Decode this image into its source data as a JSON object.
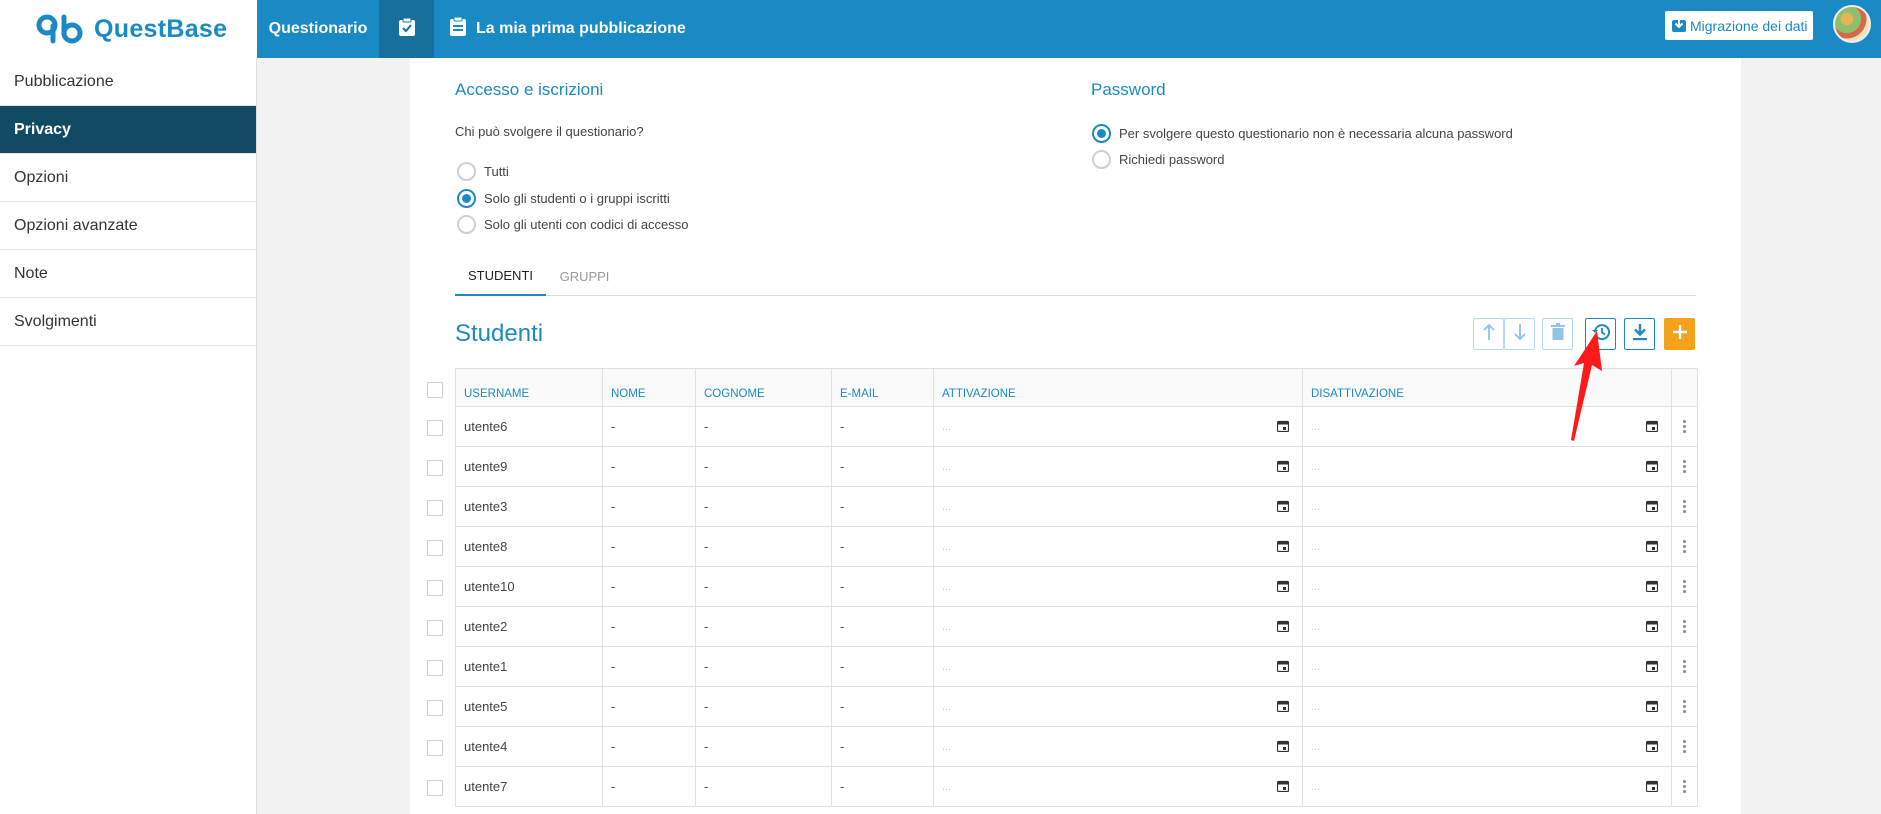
{
  "header": {
    "logo_text": "QuestBase",
    "nav_questionario": "Questionario",
    "page_title": "La mia prima pubblicazione",
    "migration_label": "Migrazione dei dati"
  },
  "sidebar": {
    "items": [
      {
        "label": "Pubblicazione",
        "active": false
      },
      {
        "label": "Privacy",
        "active": true
      },
      {
        "label": "Opzioni",
        "active": false
      },
      {
        "label": "Opzioni avanzate",
        "active": false
      },
      {
        "label": "Note",
        "active": false
      },
      {
        "label": "Svolgimenti",
        "active": false
      }
    ]
  },
  "access": {
    "title": "Accesso e iscrizioni",
    "question": "Chi può svolgere il questionario?",
    "options": [
      {
        "label": "Tutti",
        "selected": false
      },
      {
        "label": "Solo gli studenti o i gruppi iscritti",
        "selected": true
      },
      {
        "label": "Solo gli utenti con codici di accesso",
        "selected": false
      }
    ]
  },
  "password": {
    "title": "Password",
    "options": [
      {
        "label": "Per svolgere questo questionario non è necessaria alcuna password",
        "selected": true
      },
      {
        "label": "Richiedi password",
        "selected": false
      }
    ]
  },
  "tabs": [
    {
      "label": "STUDENTI",
      "active": true
    },
    {
      "label": "GRUPPI",
      "active": false
    }
  ],
  "students": {
    "title": "Studenti",
    "columns": [
      "USERNAME",
      "NOME",
      "COGNOME",
      "E-MAIL",
      "ATTIVAZIONE",
      "DISATTIVAZIONE"
    ],
    "date_placeholder": "...",
    "rows": [
      {
        "username": "utente6",
        "nome": "-",
        "cognome": "-",
        "email": "-"
      },
      {
        "username": "utente9",
        "nome": "-",
        "cognome": "-",
        "email": "-"
      },
      {
        "username": "utente3",
        "nome": "-",
        "cognome": "-",
        "email": "-"
      },
      {
        "username": "utente8",
        "nome": "-",
        "cognome": "-",
        "email": "-"
      },
      {
        "username": "utente10",
        "nome": "-",
        "cognome": "-",
        "email": "-"
      },
      {
        "username": "utente2",
        "nome": "-",
        "cognome": "-",
        "email": "-"
      },
      {
        "username": "utente1",
        "nome": "-",
        "cognome": "-",
        "email": "-"
      },
      {
        "username": "utente5",
        "nome": "-",
        "cognome": "-",
        "email": "-"
      },
      {
        "username": "utente4",
        "nome": "-",
        "cognome": "-",
        "email": "-"
      },
      {
        "username": "utente7",
        "nome": "-",
        "cognome": "-",
        "email": "-"
      }
    ]
  },
  "toolbar_icons": [
    "arrow-up-icon",
    "arrow-down-icon",
    "trash-icon",
    "history-icon",
    "download-icon",
    "plus-icon"
  ],
  "colors": {
    "primary": "#1a8ac4",
    "sidebar_active": "#124a64",
    "add_button": "#f4a21b",
    "annotation_arrow": "#ff1a1a"
  }
}
